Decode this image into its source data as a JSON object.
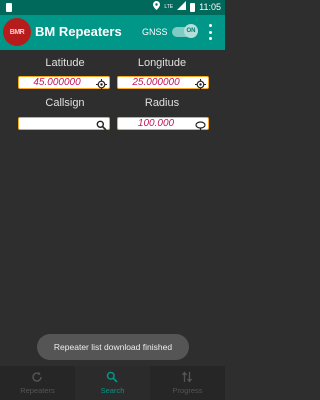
{
  "status_bar": {
    "time": "11:05",
    "network": "LTE"
  },
  "app_bar": {
    "title": "BM Repeaters",
    "logo_text": "BMR",
    "gnss_label": "GNSS",
    "gnss_toggle": "ON"
  },
  "form": {
    "latitude_label": "Latitude",
    "latitude_value": "45.000000",
    "longitude_label": "Longitude",
    "longitude_value": "25.000000",
    "callsign_label": "Callsign",
    "callsign_value": "",
    "radius_label": "Radius",
    "radius_value": "100.000"
  },
  "toast": "Repeater list download finished",
  "bottom_nav": [
    {
      "label": "Repeaters",
      "icon": "refresh-icon"
    },
    {
      "label": "Search",
      "icon": "search-icon",
      "active": true
    },
    {
      "label": "Progress",
      "icon": "progress-icon"
    }
  ],
  "colors": {
    "primary": "#009688",
    "status_bar": "#00695c",
    "value_text": "#c2185b",
    "field_border": "#f9a825"
  }
}
